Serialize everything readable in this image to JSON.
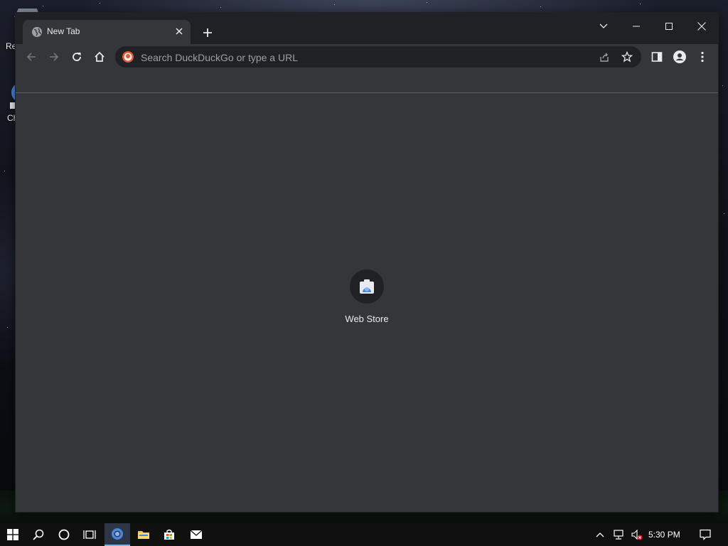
{
  "desktop": {
    "icons": [
      {
        "label": "Re"
      },
      {
        "label": "Ch"
      }
    ]
  },
  "browser": {
    "tab": {
      "title": "New Tab"
    },
    "omnibox": {
      "placeholder": "Search DuckDuckGo or type a URL"
    },
    "shortcuts": [
      {
        "label": "Web Store"
      }
    ]
  },
  "taskbar": {
    "clock": "5:30 PM"
  },
  "colors": {
    "frame": "#202124",
    "toolbar": "#35363a",
    "text": "#e8eaed",
    "icon": "#9aa0a6",
    "accent": "#8ab4f8"
  }
}
